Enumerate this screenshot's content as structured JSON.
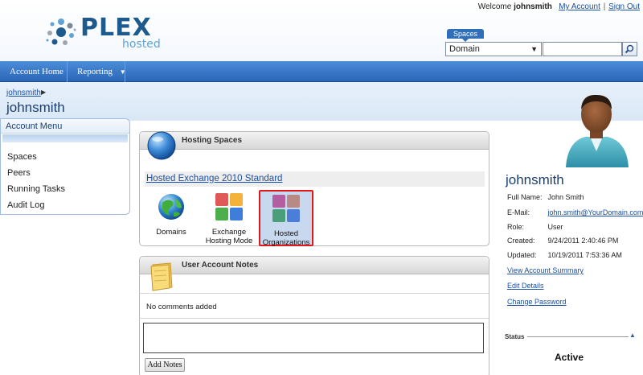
{
  "header": {
    "welcome_prefix": "Welcome",
    "username": "johnsmith",
    "my_account_link": "My Account",
    "separator": "|",
    "sign_out_link": "Sign Out",
    "logo_text": "PLEX",
    "logo_subtext": "hosted"
  },
  "search": {
    "spaces_tab": "Spaces",
    "scope_selected": "Domain",
    "query_value": ""
  },
  "nav": {
    "account_home": "Account Home",
    "reporting": "Reporting"
  },
  "breadcrumb": {
    "link": "johnsmith",
    "title": "johnsmith"
  },
  "account_menu": {
    "title": "Account Menu",
    "items": [
      "Spaces",
      "Peers",
      "Running Tasks",
      "Audit Log"
    ]
  },
  "hosting_spaces": {
    "title": "Hosting Spaces",
    "space_link": "Hosted Exchange 2010 Standard",
    "tiles": {
      "domains": "Domains",
      "exchange_line1": "Exchange",
      "exchange_line2": "Hosting Mode",
      "hosted_line1": "Hosted",
      "hosted_line2": "Organizations"
    }
  },
  "notes": {
    "title": "User Account Notes",
    "empty_message": "No comments added",
    "textarea_value": "",
    "add_button": "Add Notes"
  },
  "user": {
    "name": "johnsmith",
    "fields": {
      "full_name_label": "Full Name:",
      "full_name": "John Smith",
      "email_label": "E-Mail:",
      "email": "john.smith@YourDomain.com",
      "role_label": "Role:",
      "role": "User",
      "created_label": "Created:",
      "created": "9/24/2011 2:40:46 PM",
      "updated_label": "Updated:",
      "updated": "10/19/2011 7:53:36 AM"
    },
    "links": {
      "summary": "View Account Summary",
      "edit": "Edit Details",
      "password": "Change Password"
    },
    "status_label": "Status",
    "status_value": "Active"
  },
  "colors": {
    "nav_blue": "#2a66b8",
    "link_blue": "#1a4fa0",
    "highlight_red": "#e01a1a"
  }
}
